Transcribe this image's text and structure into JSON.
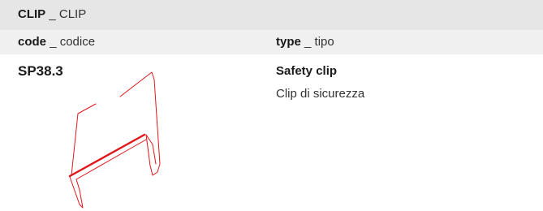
{
  "header": {
    "title_en": "CLIP",
    "separator": "_",
    "title_it": "CLIP"
  },
  "columns": {
    "code": {
      "label_en": "code",
      "separator": "_",
      "label_it": "codice"
    },
    "type": {
      "label_en": "type",
      "separator": "_",
      "label_it": "tipo"
    }
  },
  "rows": [
    {
      "code": "SP38.3",
      "type_en": "Safety clip",
      "type_it": "Clip di sicurezza",
      "drawing": "safety-clip-line-drawing",
      "line_color": "#e0161b"
    }
  ],
  "colors": {
    "header_bg": "#e6e6e6",
    "column_bg": "#f0f0f0",
    "line_color": "#e0161b"
  }
}
